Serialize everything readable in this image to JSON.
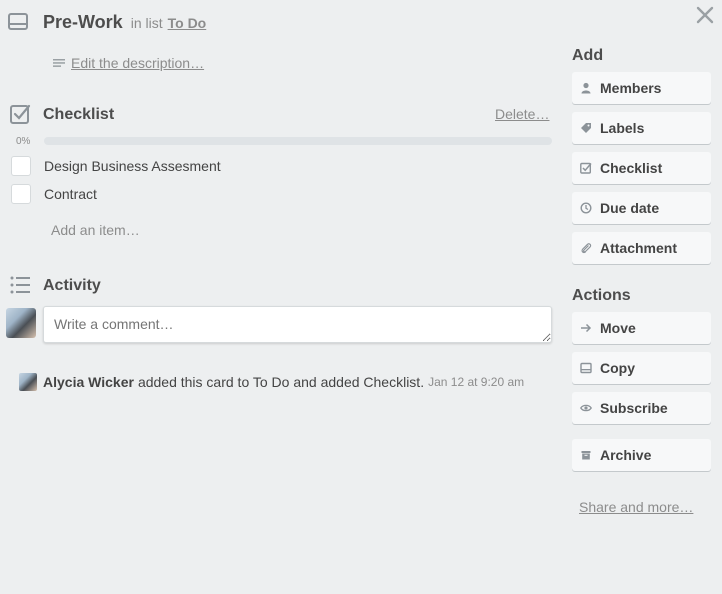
{
  "card": {
    "title": "Pre-Work",
    "in_list_prefix": "in list",
    "list_name": "To Do",
    "edit_description": "Edit the description…"
  },
  "checklist": {
    "title": "Checklist",
    "delete_label": "Delete…",
    "progress_label": "0%",
    "progress_fraction": 0,
    "items": [
      {
        "label": "Design Business Assesment",
        "checked": false
      },
      {
        "label": "Contract",
        "checked": false
      }
    ],
    "add_item": "Add an item…"
  },
  "activity": {
    "title": "Activity",
    "comment_placeholder": "Write a comment…",
    "entries": [
      {
        "user": "Alycia Wicker",
        "text": "added this card to To Do and added Checklist.",
        "time": "Jan 12 at 9:20 am"
      }
    ]
  },
  "sidebar": {
    "add_title": "Add",
    "add_buttons": [
      {
        "label": "Members",
        "icon": "person-icon"
      },
      {
        "label": "Labels",
        "icon": "tag-icon"
      },
      {
        "label": "Checklist",
        "icon": "checkbox-icon"
      },
      {
        "label": "Due date",
        "icon": "clock-icon"
      },
      {
        "label": "Attachment",
        "icon": "paperclip-icon"
      }
    ],
    "actions_title": "Actions",
    "action_buttons": [
      {
        "label": "Move",
        "icon": "arrow-right-icon"
      },
      {
        "label": "Copy",
        "icon": "card-icon"
      },
      {
        "label": "Subscribe",
        "icon": "eye-icon"
      },
      {
        "label": "Archive",
        "icon": "archive-icon"
      }
    ],
    "share_more": "Share and more…"
  },
  "colors": {
    "background": "#edeff0",
    "button_bg": "#f7f8f9",
    "progress": "#5ba4cf"
  }
}
